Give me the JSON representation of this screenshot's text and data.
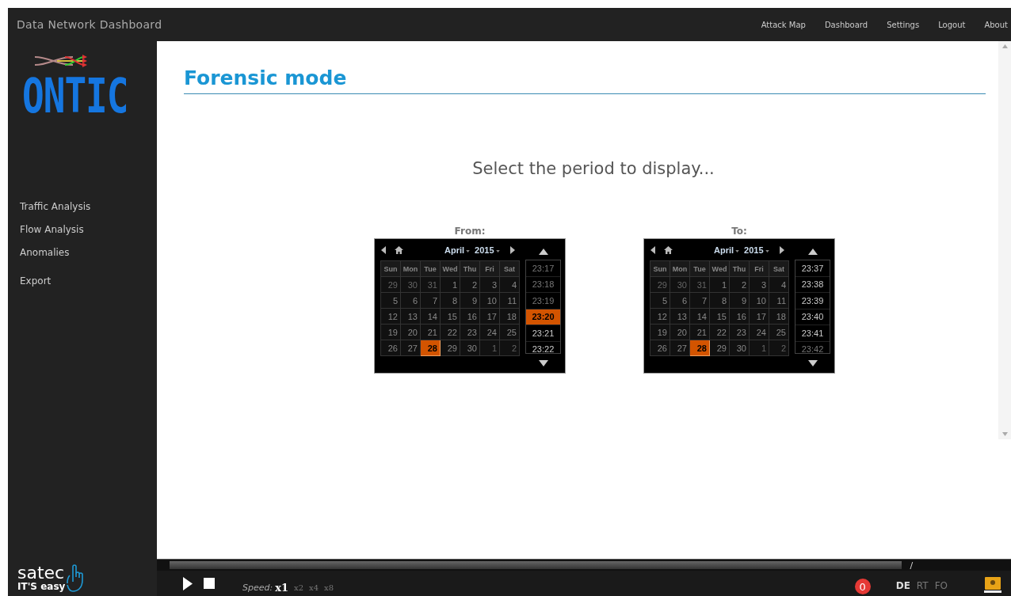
{
  "header": {
    "title": "Data Network Dashboard",
    "nav": [
      "Attack Map",
      "Dashboard",
      "Settings",
      "Logout",
      "About"
    ]
  },
  "sidebar": {
    "logo": "ONTIC",
    "groups": [
      [
        "Traffic Analysis",
        "Flow Analysis",
        "Anomalies"
      ],
      [
        "Export"
      ]
    ],
    "brand": "satec",
    "tagline": "IT'S easy"
  },
  "main": {
    "title": "Forensic mode",
    "prompt": "Select the period to display...",
    "pickers": [
      {
        "label": "From:",
        "month": "April",
        "year": "2015",
        "weekdays": [
          "Sun",
          "Mon",
          "Tue",
          "Wed",
          "Thu",
          "Fri",
          "Sat"
        ],
        "days": [
          {
            "label": "29",
            "muted": true,
            "selected": false
          },
          {
            "label": "30",
            "muted": true,
            "selected": false
          },
          {
            "label": "31",
            "muted": true,
            "selected": false
          },
          {
            "label": "1",
            "muted": false,
            "selected": false
          },
          {
            "label": "2",
            "muted": false,
            "selected": false
          },
          {
            "label": "3",
            "muted": false,
            "selected": false
          },
          {
            "label": "4",
            "muted": false,
            "selected": false
          },
          {
            "label": "5",
            "muted": false,
            "selected": false
          },
          {
            "label": "6",
            "muted": false,
            "selected": false
          },
          {
            "label": "7",
            "muted": false,
            "selected": false
          },
          {
            "label": "8",
            "muted": false,
            "selected": false
          },
          {
            "label": "9",
            "muted": false,
            "selected": false
          },
          {
            "label": "10",
            "muted": false,
            "selected": false
          },
          {
            "label": "11",
            "muted": false,
            "selected": false
          },
          {
            "label": "12",
            "muted": false,
            "selected": false
          },
          {
            "label": "13",
            "muted": false,
            "selected": false
          },
          {
            "label": "14",
            "muted": false,
            "selected": false
          },
          {
            "label": "15",
            "muted": false,
            "selected": false
          },
          {
            "label": "16",
            "muted": false,
            "selected": false
          },
          {
            "label": "17",
            "muted": false,
            "selected": false
          },
          {
            "label": "18",
            "muted": false,
            "selected": false
          },
          {
            "label": "19",
            "muted": false,
            "selected": false
          },
          {
            "label": "20",
            "muted": false,
            "selected": false
          },
          {
            "label": "21",
            "muted": false,
            "selected": false
          },
          {
            "label": "22",
            "muted": false,
            "selected": false
          },
          {
            "label": "23",
            "muted": false,
            "selected": false
          },
          {
            "label": "24",
            "muted": false,
            "selected": false
          },
          {
            "label": "25",
            "muted": false,
            "selected": false
          },
          {
            "label": "26",
            "muted": false,
            "selected": false
          },
          {
            "label": "27",
            "muted": false,
            "selected": false
          },
          {
            "label": "28",
            "muted": false,
            "selected": true
          },
          {
            "label": "29",
            "muted": false,
            "selected": false
          },
          {
            "label": "30",
            "muted": false,
            "selected": false
          },
          {
            "label": "1",
            "muted": true,
            "selected": false
          },
          {
            "label": "2",
            "muted": true,
            "selected": false
          }
        ],
        "times": [
          {
            "label": "23:17",
            "muted": true,
            "selected": false
          },
          {
            "label": "23:18",
            "muted": true,
            "selected": false
          },
          {
            "label": "23:19",
            "muted": true,
            "selected": false
          },
          {
            "label": "23:20",
            "muted": false,
            "selected": true
          },
          {
            "label": "23:21",
            "muted": false,
            "selected": false
          },
          {
            "label": "23:22",
            "muted": false,
            "selected": false
          }
        ]
      },
      {
        "label": "To:",
        "month": "April",
        "year": "2015",
        "weekdays": [
          "Sun",
          "Mon",
          "Tue",
          "Wed",
          "Thu",
          "Fri",
          "Sat"
        ],
        "days": [
          {
            "label": "29",
            "muted": true,
            "selected": false
          },
          {
            "label": "30",
            "muted": true,
            "selected": false
          },
          {
            "label": "31",
            "muted": true,
            "selected": false
          },
          {
            "label": "1",
            "muted": false,
            "selected": false
          },
          {
            "label": "2",
            "muted": false,
            "selected": false
          },
          {
            "label": "3",
            "muted": false,
            "selected": false
          },
          {
            "label": "4",
            "muted": false,
            "selected": false
          },
          {
            "label": "5",
            "muted": false,
            "selected": false
          },
          {
            "label": "6",
            "muted": false,
            "selected": false
          },
          {
            "label": "7",
            "muted": false,
            "selected": false
          },
          {
            "label": "8",
            "muted": false,
            "selected": false
          },
          {
            "label": "9",
            "muted": false,
            "selected": false
          },
          {
            "label": "10",
            "muted": false,
            "selected": false
          },
          {
            "label": "11",
            "muted": false,
            "selected": false
          },
          {
            "label": "12",
            "muted": false,
            "selected": false
          },
          {
            "label": "13",
            "muted": false,
            "selected": false
          },
          {
            "label": "14",
            "muted": false,
            "selected": false
          },
          {
            "label": "15",
            "muted": false,
            "selected": false
          },
          {
            "label": "16",
            "muted": false,
            "selected": false
          },
          {
            "label": "17",
            "muted": false,
            "selected": false
          },
          {
            "label": "18",
            "muted": false,
            "selected": false
          },
          {
            "label": "19",
            "muted": false,
            "selected": false
          },
          {
            "label": "20",
            "muted": false,
            "selected": false
          },
          {
            "label": "21",
            "muted": false,
            "selected": false
          },
          {
            "label": "22",
            "muted": false,
            "selected": false
          },
          {
            "label": "23",
            "muted": false,
            "selected": false
          },
          {
            "label": "24",
            "muted": false,
            "selected": false
          },
          {
            "label": "25",
            "muted": false,
            "selected": false
          },
          {
            "label": "26",
            "muted": false,
            "selected": false
          },
          {
            "label": "27",
            "muted": false,
            "selected": false
          },
          {
            "label": "28",
            "muted": false,
            "selected": true
          },
          {
            "label": "29",
            "muted": false,
            "selected": false
          },
          {
            "label": "30",
            "muted": false,
            "selected": false
          },
          {
            "label": "1",
            "muted": true,
            "selected": false
          },
          {
            "label": "2",
            "muted": true,
            "selected": false
          }
        ],
        "times": [
          {
            "label": "23:37",
            "muted": false,
            "selected": false
          },
          {
            "label": "23:38",
            "muted": false,
            "selected": false
          },
          {
            "label": "23:39",
            "muted": false,
            "selected": false
          },
          {
            "label": "23:40",
            "muted": false,
            "selected": false
          },
          {
            "label": "23:41",
            "muted": false,
            "selected": false
          },
          {
            "label": "23:42",
            "muted": true,
            "selected": false
          }
        ]
      }
    ]
  },
  "player": {
    "level": 0.875,
    "marker": "/",
    "speed_label": "Speed:",
    "speeds": [
      {
        "label": "x1",
        "selected": true
      },
      {
        "label": "x2",
        "selected": false
      },
      {
        "label": "x4",
        "selected": false
      },
      {
        "label": "x8",
        "selected": false
      }
    ],
    "alerts": "0",
    "modes": [
      {
        "label": "DE",
        "selected": true
      },
      {
        "label": "RT",
        "selected": false
      },
      {
        "label": "FO",
        "selected": false
      }
    ]
  }
}
